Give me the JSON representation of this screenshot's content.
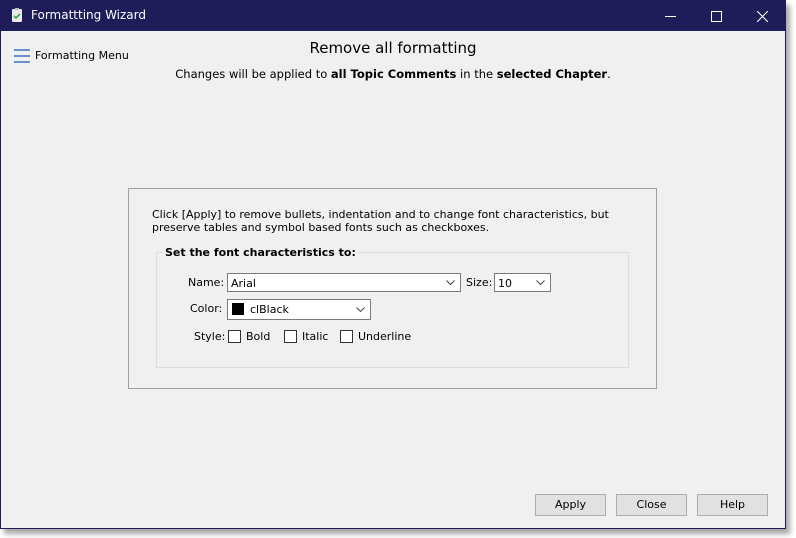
{
  "window": {
    "title": "Formattting Wizard",
    "app_icon": "clipboard-check-icon",
    "controls": {
      "minimize": "minimize-icon",
      "maximize": "maximize-icon",
      "close": "close-icon"
    },
    "colors": {
      "titlebar": "#1f1c5a",
      "background": "#f0f0f0"
    }
  },
  "menu": {
    "icon": "hamburger-icon",
    "label": "Formatting Menu"
  },
  "header": {
    "title": "Remove all formatting",
    "subtitle_parts": {
      "p1": "Changes will be applied to ",
      "b1": "all Topic Comments",
      "p2": " in the ",
      "b2": "selected Chapter",
      "p3": "."
    }
  },
  "panel": {
    "description": "Click [Apply] to remove bullets, indentation and to change font characteristics, but preserve tables and symbol based fonts such as checkboxes.",
    "group": {
      "label": "Set the font characteristics to:",
      "name_label": "Name:",
      "name_value": "Arial",
      "size_label": "Size:",
      "size_value": "10",
      "color_label": "Color:",
      "color_value": "clBlack",
      "color_swatch": "#000000",
      "style_label": "Style:",
      "styles": [
        {
          "label": "Bold",
          "checked": false
        },
        {
          "label": "Italic",
          "checked": false
        },
        {
          "label": "Underline",
          "checked": false
        }
      ]
    }
  },
  "buttons": {
    "apply": "Apply",
    "close": "Close",
    "help": "Help"
  }
}
